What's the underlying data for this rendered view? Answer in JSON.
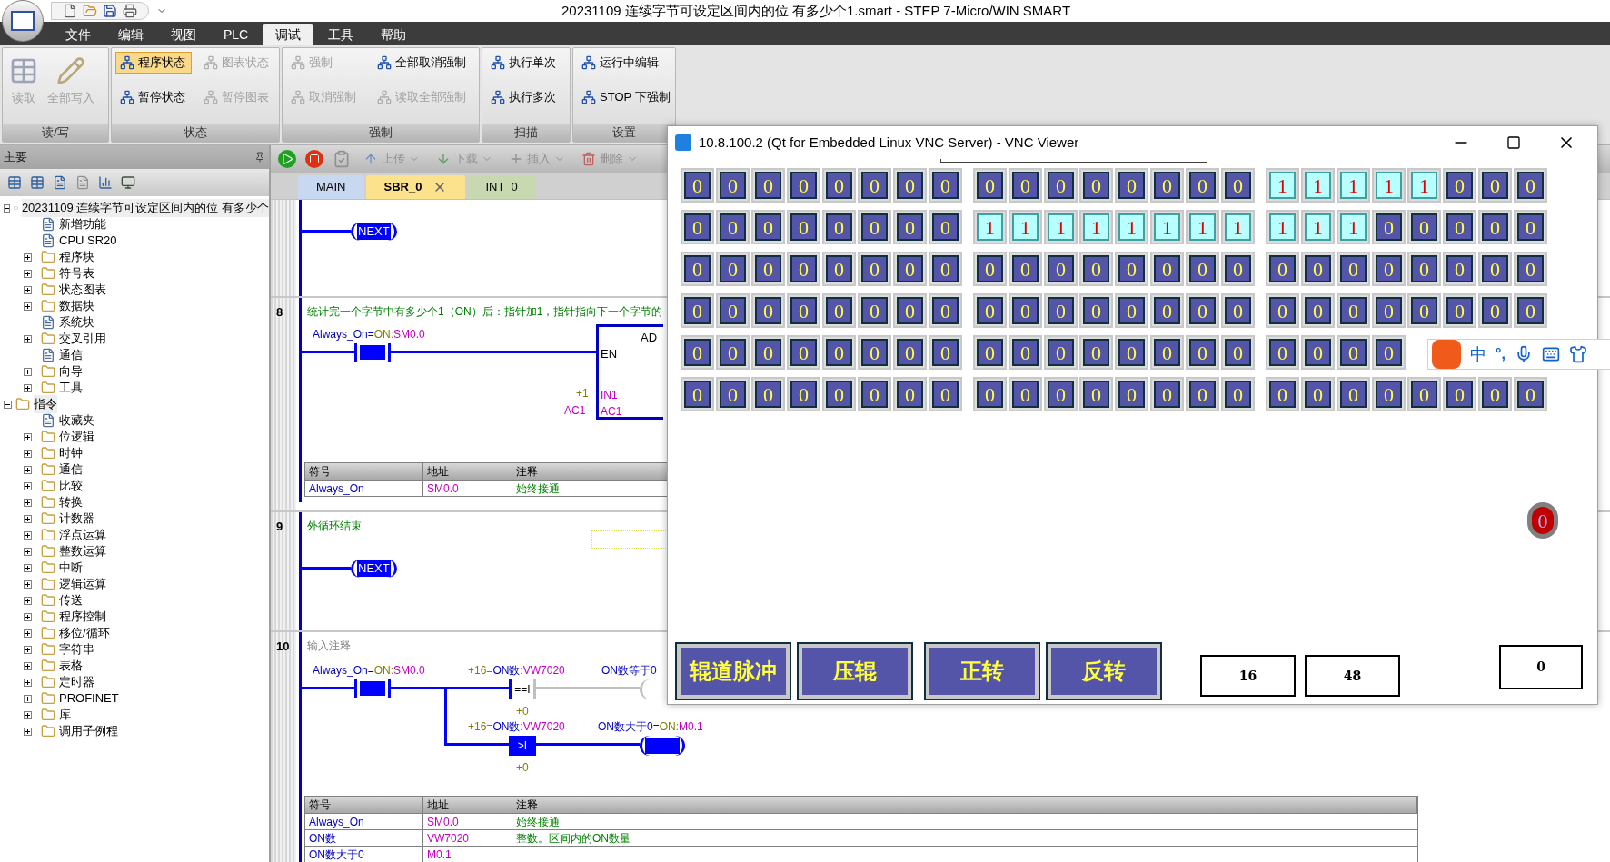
{
  "window": {
    "title": "20231109 连续字节可设定区间内的位 有多少个1.smart - STEP 7-Micro/WIN SMART"
  },
  "menu": [
    {
      "label": "文件",
      "selected": false
    },
    {
      "label": "编辑",
      "selected": false
    },
    {
      "label": "视图",
      "selected": false
    },
    {
      "label": "PLC",
      "selected": false
    },
    {
      "label": "调试",
      "selected": true
    },
    {
      "label": "工具",
      "selected": false
    },
    {
      "label": "帮助",
      "selected": false
    }
  ],
  "ribbon": [
    {
      "label": "读/写",
      "kind": "large",
      "buttons": [
        {
          "label": "读取",
          "disabled": true,
          "selected": false
        },
        {
          "label": "全部写入",
          "disabled": true,
          "selected": false
        }
      ]
    },
    {
      "label": "状态",
      "kind": "small",
      "buttons": [
        {
          "label": "程序状态",
          "disabled": false,
          "selected": true
        },
        {
          "label": "暂停状态",
          "disabled": false,
          "selected": false
        },
        {
          "label": "图表状态",
          "disabled": true,
          "selected": false
        },
        {
          "label": "暂停图表",
          "disabled": true,
          "selected": false
        }
      ]
    },
    {
      "label": "强制",
      "kind": "small",
      "buttons": [
        {
          "label": "强制",
          "disabled": true,
          "selected": false
        },
        {
          "label": "取消强制",
          "disabled": true,
          "selected": false
        },
        {
          "label": "全部取消强制",
          "disabled": false,
          "selected": false
        },
        {
          "label": "读取全部强制",
          "disabled": true,
          "selected": false
        }
      ]
    },
    {
      "label": "扫描",
      "kind": "small",
      "buttons": [
        {
          "label": "执行单次",
          "disabled": false,
          "selected": false
        },
        {
          "label": "执行多次",
          "disabled": false,
          "selected": false
        }
      ]
    },
    {
      "label": "设置",
      "kind": "small",
      "buttons": [
        {
          "label": "运行中编辑",
          "disabled": false,
          "selected": false
        },
        {
          "label": "STOP 下强制",
          "disabled": false,
          "selected": false
        }
      ]
    }
  ],
  "left_pane": {
    "title": "主要",
    "tree": [
      {
        "label": "20231109 连续字节可设定区间内的位 有多少个",
        "expanded": true,
        "children": [
          {
            "label": "新增功能",
            "expandable": false
          },
          {
            "label": "CPU SR20",
            "expandable": false
          },
          {
            "label": "程序块",
            "expandable": true
          },
          {
            "label": "符号表",
            "expandable": true
          },
          {
            "label": "状态图表",
            "expandable": true
          },
          {
            "label": "数据块",
            "expandable": true
          },
          {
            "label": "系统块",
            "expandable": false
          },
          {
            "label": "交叉引用",
            "expandable": true
          },
          {
            "label": "通信",
            "expandable": false
          },
          {
            "label": "向导",
            "expandable": true
          },
          {
            "label": "工具",
            "expandable": true
          }
        ]
      },
      {
        "label": "指令",
        "expanded": true,
        "children": [
          {
            "label": "收藏夹",
            "expandable": false
          },
          {
            "label": "位逻辑",
            "expandable": true
          },
          {
            "label": "时钟",
            "expandable": true
          },
          {
            "label": "通信",
            "expandable": true
          },
          {
            "label": "比较",
            "expandable": true
          },
          {
            "label": "转换",
            "expandable": true
          },
          {
            "label": "计数器",
            "expandable": true
          },
          {
            "label": "浮点运算",
            "expandable": true
          },
          {
            "label": "整数运算",
            "expandable": true
          },
          {
            "label": "中断",
            "expandable": true
          },
          {
            "label": "逻辑运算",
            "expandable": true
          },
          {
            "label": "传送",
            "expandable": true
          },
          {
            "label": "程序控制",
            "expandable": true
          },
          {
            "label": "移位/循环",
            "expandable": true
          },
          {
            "label": "字符串",
            "expandable": true
          },
          {
            "label": "表格",
            "expandable": true
          },
          {
            "label": "定时器",
            "expandable": true
          },
          {
            "label": "PROFINET",
            "expandable": true
          },
          {
            "label": "库",
            "expandable": true
          },
          {
            "label": "调用子例程",
            "expandable": true
          }
        ]
      }
    ]
  },
  "editor": {
    "toolbar": [
      {
        "label": "上传",
        "disabled": true
      },
      {
        "label": "下载",
        "disabled": true
      },
      {
        "label": "插入",
        "disabled": true
      },
      {
        "label": "删除",
        "disabled": true
      }
    ],
    "tabs": [
      {
        "label": "MAIN",
        "selected": false
      },
      {
        "label": "SBR_0",
        "selected": true
      },
      {
        "label": "INT_0",
        "selected": false
      }
    ],
    "networks": [
      {
        "kind": "next",
        "coil": "NEXT"
      },
      {
        "kind": "add",
        "number": "8",
        "comment": "统计完一个字节中有多少个1（ON）后：指针加1，指针指向下一个字节的",
        "contact": {
          "energized": true,
          "operand": [
            {
              "kind": "symbol",
              "text": "Always_On="
            },
            {
              "kind": "value",
              "text": "ON:"
            },
            {
              "kind": "address",
              "text": "SM0.0"
            }
          ]
        },
        "box": {
          "title": "AD",
          "en": "EN",
          "in1": "IN1",
          "in1_value": "+1",
          "out": "AC1",
          "out_value": "AC1"
        },
        "table": {
          "columns": [
            "符号",
            "地址",
            "注释"
          ],
          "rows": [
            {
              "symbol": "Always_On",
              "address": "SM0.0",
              "comment": "始终接通"
            }
          ]
        }
      },
      {
        "kind": "next",
        "number": "9",
        "comment": "外循环结束",
        "coil": "NEXT"
      },
      {
        "kind": "compare",
        "number": "10",
        "comment_placeholder": "输入注释",
        "contact": {
          "energized": true,
          "operand": [
            {
              "kind": "symbol",
              "text": "Always_On="
            },
            {
              "kind": "value",
              "text": "ON:"
            },
            {
              "kind": "address",
              "text": "SM0.0"
            }
          ]
        },
        "compares": [
          {
            "op": "==I",
            "energized": false,
            "operand": [
              {
                "kind": "value",
                "text": "+16="
              },
              {
                "kind": "symbol",
                "text": "ON数:"
              },
              {
                "kind": "address",
                "text": "VW7020"
              }
            ],
            "operand2": "+0",
            "coil": [
              {
                "kind": "symbol",
                "text": "ON数等于0"
              }
            ]
          },
          {
            "op": ">I",
            "energized": true,
            "operand": [
              {
                "kind": "value",
                "text": "+16="
              },
              {
                "kind": "symbol",
                "text": "ON数:"
              },
              {
                "kind": "address",
                "text": "VW7020"
              }
            ],
            "operand2": "+0",
            "coil": [
              {
                "kind": "symbol",
                "text": "ON数大于0="
              },
              {
                "kind": "value",
                "text": "ON:"
              },
              {
                "kind": "address",
                "text": "M0.1"
              }
            ]
          }
        ],
        "table": {
          "columns": [
            "符号",
            "地址",
            "注释"
          ],
          "rows": [
            {
              "symbol": "Always_On",
              "address": "SM0.0",
              "comment": "始终接通"
            },
            {
              "symbol": "ON数",
              "address": "VW7020",
              "comment": "整数。区间内的ON数量"
            },
            {
              "symbol": "ON数大于0",
              "address": "M0.1"
            }
          ]
        }
      }
    ]
  },
  "vnc": {
    "title": "10.8.100.2 (Qt for Embedded Linux VNC Server) - VNC Viewer",
    "rows": [
      [
        [
          {
            "value": "0",
            "on": false
          },
          {
            "value": "0",
            "on": false
          },
          {
            "value": "0",
            "on": false
          },
          {
            "value": "0",
            "on": false
          },
          {
            "value": "0",
            "on": false
          },
          {
            "value": "0",
            "on": false
          },
          {
            "value": "0",
            "on": false
          },
          {
            "value": "0",
            "on": false
          }
        ],
        [
          {
            "value": "0",
            "on": false
          },
          {
            "value": "0",
            "on": false
          },
          {
            "value": "0",
            "on": false
          },
          {
            "value": "0",
            "on": false
          },
          {
            "value": "0",
            "on": false
          },
          {
            "value": "0",
            "on": false
          },
          {
            "value": "0",
            "on": false
          },
          {
            "value": "0",
            "on": false
          }
        ],
        [
          {
            "value": "1",
            "on": true
          },
          {
            "value": "1",
            "on": true
          },
          {
            "value": "1",
            "on": true
          },
          {
            "value": "1",
            "on": true
          },
          {
            "value": "1",
            "on": true
          },
          {
            "value": "0",
            "on": false
          },
          {
            "value": "0",
            "on": false
          },
          {
            "value": "0",
            "on": false
          }
        ]
      ],
      [
        [
          {
            "value": "0",
            "on": false
          },
          {
            "value": "0",
            "on": false
          },
          {
            "value": "0",
            "on": false
          },
          {
            "value": "0",
            "on": false
          },
          {
            "value": "0",
            "on": false
          },
          {
            "value": "0",
            "on": false
          },
          {
            "value": "0",
            "on": false
          },
          {
            "value": "0",
            "on": false
          }
        ],
        [
          {
            "value": "1",
            "on": true
          },
          {
            "value": "1",
            "on": true
          },
          {
            "value": "1",
            "on": true
          },
          {
            "value": "1",
            "on": true
          },
          {
            "value": "1",
            "on": true
          },
          {
            "value": "1",
            "on": true
          },
          {
            "value": "1",
            "on": true
          },
          {
            "value": "1",
            "on": true
          }
        ],
        [
          {
            "value": "1",
            "on": true
          },
          {
            "value": "1",
            "on": true
          },
          {
            "value": "1",
            "on": true
          },
          {
            "value": "0",
            "on": false
          },
          {
            "value": "0",
            "on": false
          },
          {
            "value": "0",
            "on": false
          },
          {
            "value": "0",
            "on": false
          },
          {
            "value": "0",
            "on": false
          }
        ]
      ],
      [
        [
          {
            "value": "0",
            "on": false
          },
          {
            "value": "0",
            "on": false
          },
          {
            "value": "0",
            "on": false
          },
          {
            "value": "0",
            "on": false
          },
          {
            "value": "0",
            "on": false
          },
          {
            "value": "0",
            "on": false
          },
          {
            "value": "0",
            "on": false
          },
          {
            "value": "0",
            "on": false
          }
        ],
        [
          {
            "value": "0",
            "on": false
          },
          {
            "value": "0",
            "on": false
          },
          {
            "value": "0",
            "on": false
          },
          {
            "value": "0",
            "on": false
          },
          {
            "value": "0",
            "on": false
          },
          {
            "value": "0",
            "on": false
          },
          {
            "value": "0",
            "on": false
          },
          {
            "value": "0",
            "on": false
          }
        ],
        [
          {
            "value": "0",
            "on": false
          },
          {
            "value": "0",
            "on": false
          },
          {
            "value": "0",
            "on": false
          },
          {
            "value": "0",
            "on": false
          },
          {
            "value": "0",
            "on": false
          },
          {
            "value": "0",
            "on": false
          },
          {
            "value": "0",
            "on": false
          },
          {
            "value": "0",
            "on": false
          }
        ]
      ],
      [
        [
          {
            "value": "0",
            "on": false
          },
          {
            "value": "0",
            "on": false
          },
          {
            "value": "0",
            "on": false
          },
          {
            "value": "0",
            "on": false
          },
          {
            "value": "0",
            "on": false
          },
          {
            "value": "0",
            "on": false
          },
          {
            "value": "0",
            "on": false
          },
          {
            "value": "0",
            "on": false
          }
        ],
        [
          {
            "value": "0",
            "on": false
          },
          {
            "value": "0",
            "on": false
          },
          {
            "value": "0",
            "on": false
          },
          {
            "value": "0",
            "on": false
          },
          {
            "value": "0",
            "on": false
          },
          {
            "value": "0",
            "on": false
          },
          {
            "value": "0",
            "on": false
          },
          {
            "value": "0",
            "on": false
          }
        ],
        [
          {
            "value": "0",
            "on": false
          },
          {
            "value": "0",
            "on": false
          },
          {
            "value": "0",
            "on": false
          },
          {
            "value": "0",
            "on": false
          },
          {
            "value": "0",
            "on": false
          },
          {
            "value": "0",
            "on": false
          },
          {
            "value": "0",
            "on": false
          },
          {
            "value": "0",
            "on": false
          }
        ]
      ],
      [
        [
          {
            "value": "0",
            "on": false
          },
          {
            "value": "0",
            "on": false
          },
          {
            "value": "0",
            "on": false
          },
          {
            "value": "0",
            "on": false
          },
          {
            "value": "0",
            "on": false
          },
          {
            "value": "0",
            "on": false
          },
          {
            "value": "0",
            "on": false
          },
          {
            "value": "0",
            "on": false
          }
        ],
        [
          {
            "value": "0",
            "on": false
          },
          {
            "value": "0",
            "on": false
          },
          {
            "value": "0",
            "on": false
          },
          {
            "value": "0",
            "on": false
          },
          {
            "value": "0",
            "on": false
          },
          {
            "value": "0",
            "on": false
          },
          {
            "value": "0",
            "on": false
          },
          {
            "value": "0",
            "on": false
          }
        ],
        [
          {
            "value": "0",
            "on": false
          },
          {
            "value": "0",
            "on": false
          },
          {
            "value": "0",
            "on": false
          },
          {
            "value": "0",
            "on": false
          }
        ]
      ],
      [
        [
          {
            "value": "0",
            "on": false
          },
          {
            "value": "0",
            "on": false
          },
          {
            "value": "0",
            "on": false
          },
          {
            "value": "0",
            "on": false
          },
          {
            "value": "0",
            "on": false
          },
          {
            "value": "0",
            "on": false
          },
          {
            "value": "0",
            "on": false
          },
          {
            "value": "0",
            "on": false
          }
        ],
        [
          {
            "value": "0",
            "on": false
          },
          {
            "value": "0",
            "on": false
          },
          {
            "value": "0",
            "on": false
          },
          {
            "value": "0",
            "on": false
          },
          {
            "value": "0",
            "on": false
          },
          {
            "value": "0",
            "on": false
          },
          {
            "value": "0",
            "on": false
          },
          {
            "value": "0",
            "on": false
          }
        ],
        [
          {
            "value": "0",
            "on": false
          },
          {
            "value": "0",
            "on": false
          },
          {
            "value": "0",
            "on": false
          },
          {
            "value": "0",
            "on": false
          },
          {
            "value": "0",
            "on": false
          },
          {
            "value": "0",
            "on": false
          },
          {
            "value": "0",
            "on": false
          },
          {
            "value": "0",
            "on": false
          }
        ]
      ]
    ],
    "lamp": {
      "label": "0"
    },
    "buttons": [
      "辊道脉冲",
      "压辊",
      "正转",
      "反转"
    ],
    "values": [
      "16",
      "48"
    ],
    "result": "0"
  },
  "ime_toolbar": {
    "mode": "中",
    "punctuation": "°,"
  }
}
